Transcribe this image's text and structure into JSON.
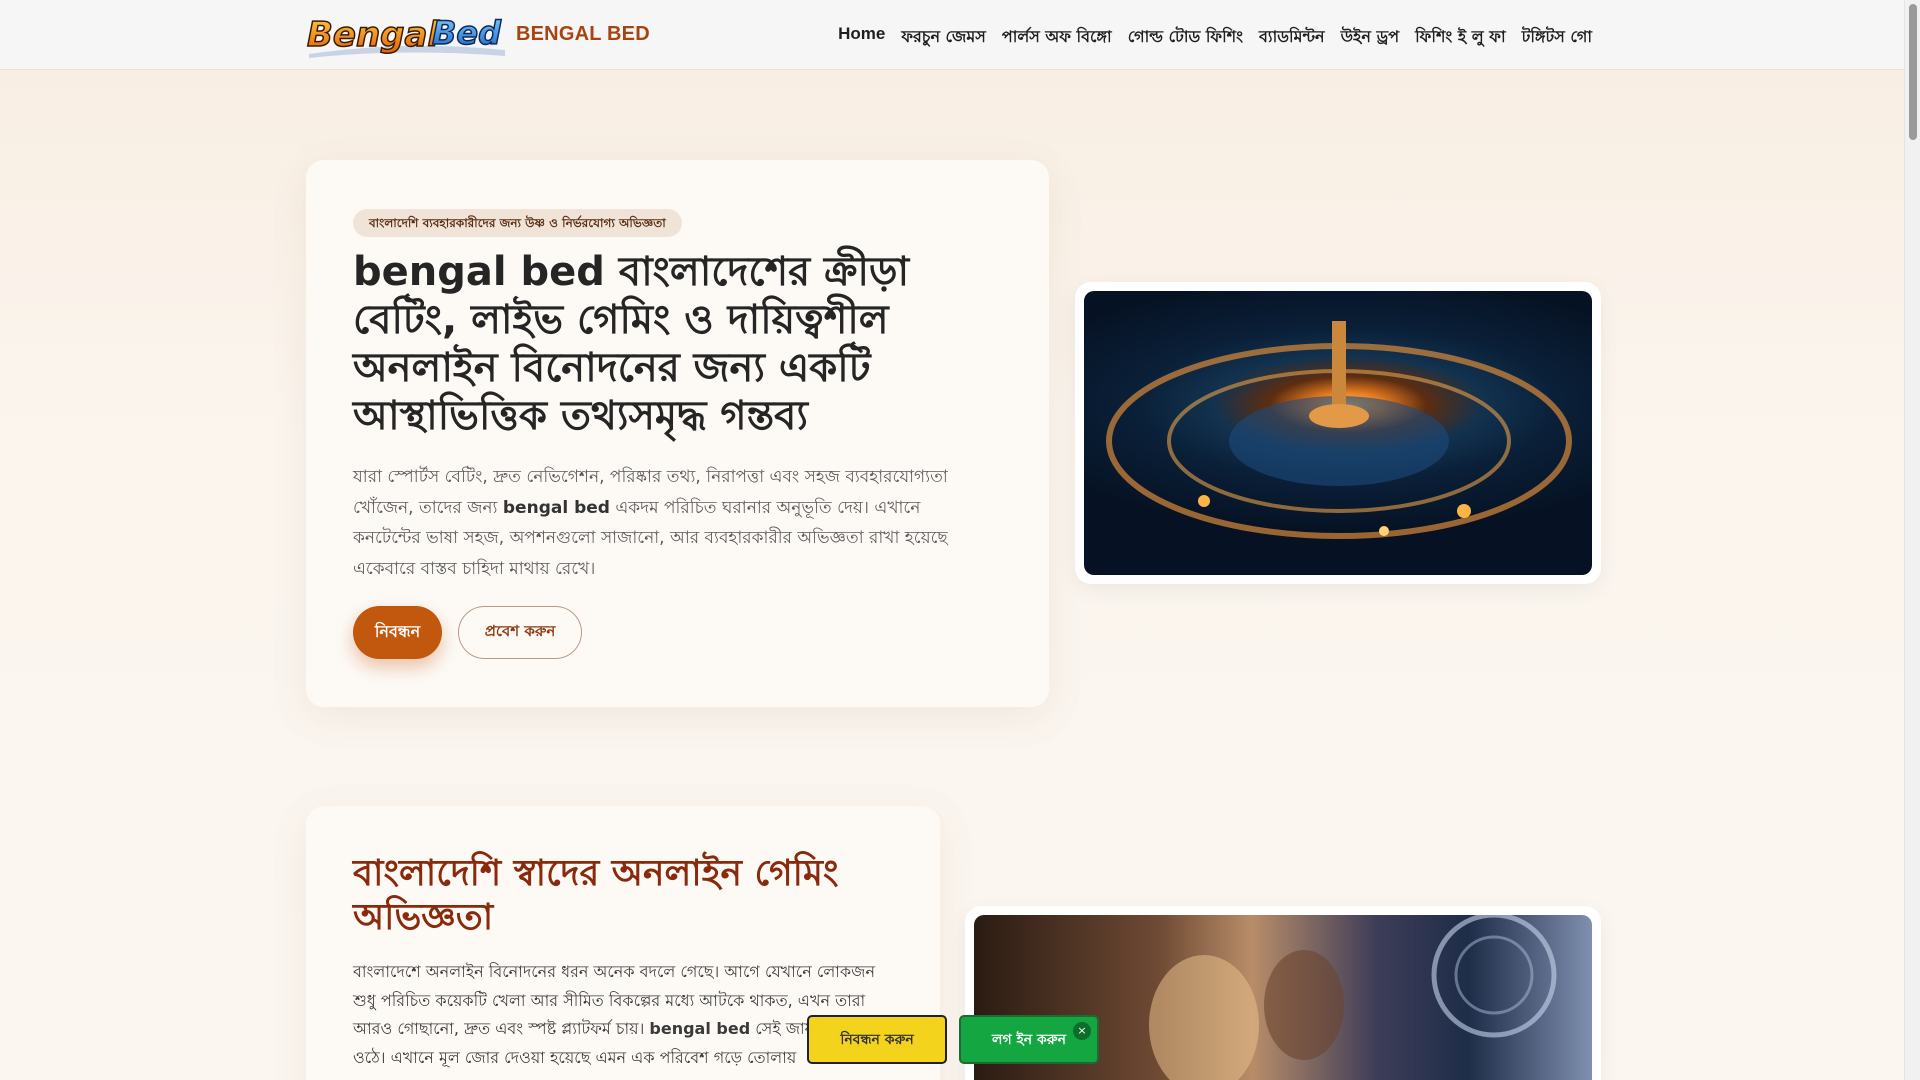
{
  "header": {
    "logo_text": "BengalBed",
    "brand": "BENGAL BED",
    "nav": [
      "Home",
      "ফরচুন জেমস",
      "পার্লস অফ বিঙ্গো",
      "গোল্ড টোড ফিশিং",
      "ব্যাডমিন্টন",
      "উইন ড্রপ",
      "ফিশিং ই লু ফা",
      "টঙ্গিটস গো"
    ]
  },
  "hero": {
    "badge": "বাংলাদেশি ব্যবহারকারীদের জন্য উষ্ণ ও নির্ভরযোগ্য অভিজ্ঞতা",
    "title": "bengal bed বাংলাদেশের ক্রীড়া বেটিং, লাইভ গেমিং ও দায়িত্বশীল অনলাইন বিনোদনের জন্য একটি আস্থাভিত্তিক তথ্যসমৃদ্ধ গন্তব্য",
    "text_before": "যারা স্পোর্টস বেটিং, দ্রুত নেভিগেশন, পরিষ্কার তথ্য, নিরাপত্তা এবং সহজ ব্যবহারযোগ্যতা খোঁজেন, তাদের জন্য ",
    "text_bold": "bengal bed",
    "text_after": " একদম পরিচিত ঘরানার অনুভূতি দেয়। এখানে কনটেন্টের ভাষা সহজ, অপশনগুলো সাজানো, আর ব্যবহারকারীর অভিজ্ঞতা রাখা হয়েছে একেবারে বাস্তব চাহিদা মাথায় রেখে।",
    "primary_button": "নিবন্ধন",
    "secondary_button": "প্রবেশ করুন"
  },
  "section2": {
    "title": "বাংলাদেশি স্বাদের অনলাইন গেমিং অভিজ্ঞতা",
    "text_before": "বাংলাদেশে অনলাইন বিনোদনের ধরন অনেক বদলে গেছে। আগে যেখানে লোকজন শুধু পরিচিত কয়েকটি খেলা আর সীমিত বিকল্পের মধ্যে আটকে থাকত, এখন তারা আরও গোছানো, দ্রুত এবং স্পষ্ট প্ল্যাটফর্ম চায়। ",
    "text_bold": "bengal bed",
    "text_after": " সেই জায়গায় হয়ে ওঠে। এখানে মূল জোর দেওয়া হয়েছে এমন এক পরিবেশ গড়ে তোলায়"
  },
  "floating": {
    "register": "নিবন্ধন করুন",
    "login": "লগ ইন করুন",
    "close": "×"
  },
  "colors": {
    "accent": "#c2570e",
    "brand": "#a64512",
    "heading_dark_red": "#8a2a0c",
    "register_yellow": "#f4d31c",
    "login_green": "#14a640"
  }
}
